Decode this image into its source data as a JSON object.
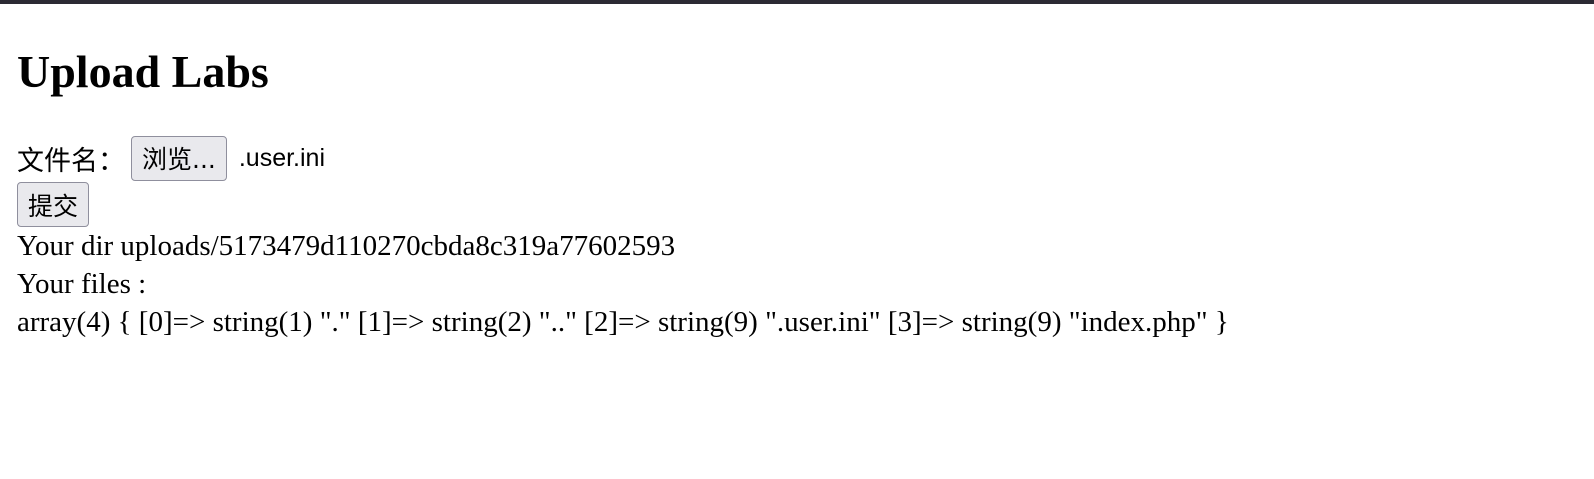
{
  "header": {
    "title": "Upload Labs"
  },
  "form": {
    "file_label": "文件名：",
    "browse_label": "浏览...",
    "file_name": ".user.ini",
    "submit_label": "提交"
  },
  "output": {
    "dir_line": "Your dir uploads/5173479d110270cbda8c319a77602593",
    "files_label": "Your files :",
    "files_dump": "array(4) { [0]=> string(1) \".\" [1]=> string(2) \"..\" [2]=> string(9) \".user.ini\" [3]=> string(9) \"index.php\" }"
  },
  "colors": {
    "top_bar": "#2b2a33",
    "button_bg": "#e9e9ed",
    "button_border": "#8f8f9d"
  }
}
